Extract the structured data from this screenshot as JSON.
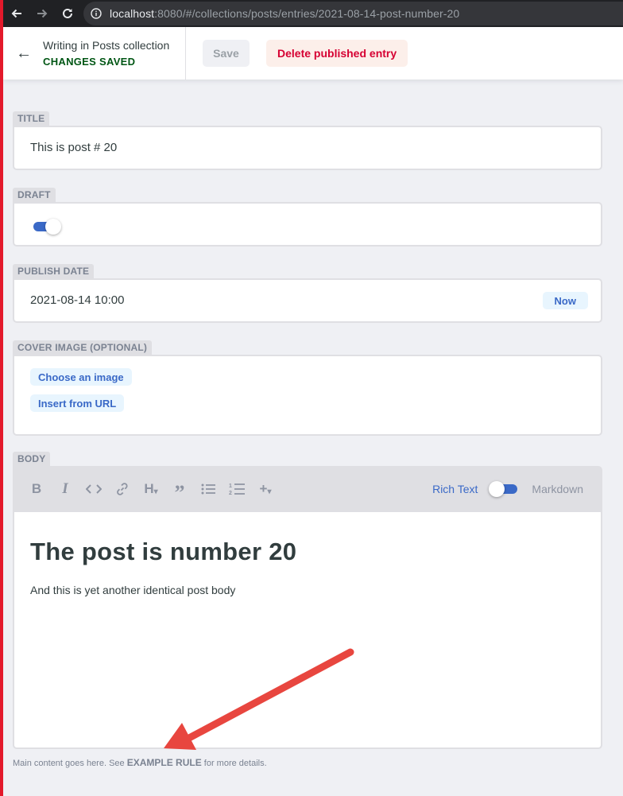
{
  "browser": {
    "url_host": "localhost",
    "url_rest": ":8080/#/collections/posts/entries/2021-08-14-post-number-20"
  },
  "toolbar": {
    "back_title": "Writing in Posts collection",
    "status": "CHANGES SAVED",
    "save_label": "Save",
    "delete_label": "Delete published entry"
  },
  "fields": {
    "title": {
      "label": "TITLE",
      "value": "This is post # 20"
    },
    "draft": {
      "label": "DRAFT",
      "enabled": true
    },
    "publish_date": {
      "label": "PUBLISH DATE",
      "value": "2021-08-14 10:00",
      "now_label": "Now"
    },
    "cover_image": {
      "label": "COVER IMAGE (OPTIONAL)",
      "choose_label": "Choose an image",
      "insert_label": "Insert from URL"
    },
    "body": {
      "label": "BODY",
      "toolbar_icons": [
        "bold-icon",
        "italic-icon",
        "code-icon",
        "link-icon",
        "heading-icon",
        "quote-icon",
        "bulleted-list-icon",
        "numbered-list-icon",
        "add-component-icon"
      ],
      "mode_rich": "Rich Text",
      "mode_markdown": "Markdown",
      "heading": "The post is number 20",
      "paragraph": "And this is yet another identical post body"
    }
  },
  "hint": {
    "before": "Main content goes here. See ",
    "rule": "EXAMPLE RULE",
    "after": " for more details."
  },
  "colors": {
    "accent": "#3a69c7",
    "saved": "#005614",
    "danger": "#d60032",
    "annotation_arrow": "#e8463f"
  }
}
